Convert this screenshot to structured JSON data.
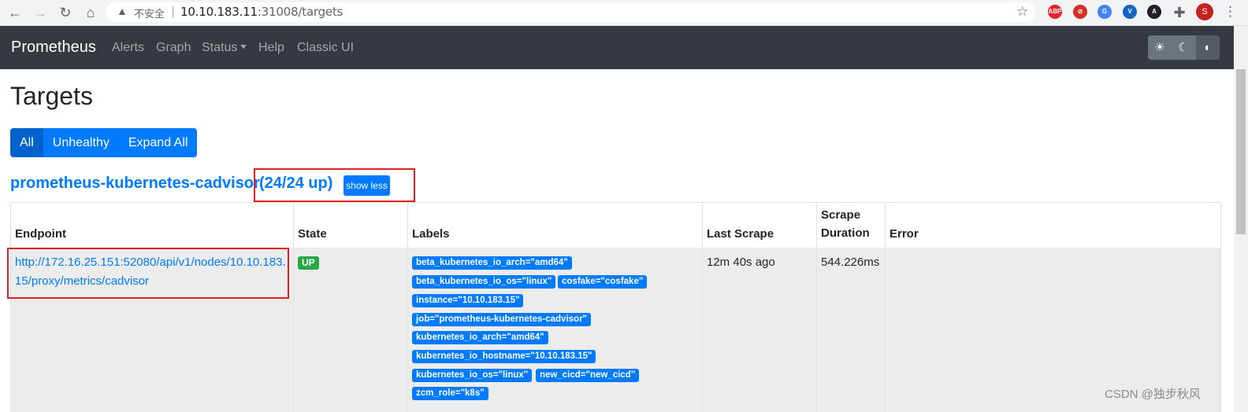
{
  "browser": {
    "insecure_label": "不安全",
    "url_host": "10.10.183.11",
    "url_path": ":31008/targets",
    "avatar_letter": "S",
    "extensions": [
      {
        "name": "abp-icon",
        "text": "ABP",
        "color": "#e4262c"
      },
      {
        "name": "block-icon",
        "text": "⊘",
        "color": "#d93025"
      },
      {
        "name": "translate-icon",
        "text": "G",
        "color": "#4285f4"
      },
      {
        "name": "v-icon",
        "text": "V",
        "color": "#1565c0"
      },
      {
        "name": "arrow-ext-icon",
        "text": "A",
        "color": "#202124"
      }
    ]
  },
  "navbar": {
    "brand": "Prometheus",
    "links": [
      "Alerts",
      "Graph",
      "Status",
      "Help",
      "Classic UI"
    ]
  },
  "page": {
    "title": "Targets",
    "filters": [
      "All",
      "Unhealthy",
      "Expand All"
    ]
  },
  "job": {
    "name": "prometheus-kubernetes-cadvisor",
    "count": "(24/24 up)",
    "toggle_label": "show less"
  },
  "table": {
    "headers": {
      "endpoint": "Endpoint",
      "state": "State",
      "labels": "Labels",
      "last_scrape": "Last Scrape",
      "scrape_duration_1": "Scrape",
      "scrape_duration_2": "Duration",
      "error": "Error"
    },
    "rows": [
      {
        "endpoint": "http://172.16.25.151:52080/api/v1/nodes/10.10.183.15/proxy/metrics/cadvisor",
        "state": "UP",
        "labels": [
          "beta_kubernetes_io_arch=\"amd64\"",
          "beta_kubernetes_io_os=\"linux\"",
          "cosfake=\"cosfake\"",
          "instance=\"10.10.183.15\"",
          "job=\"prometheus-kubernetes-cadvisor\"",
          "kubernetes_io_arch=\"amd64\"",
          "kubernetes_io_hostname=\"10.10.183.15\"",
          "kubernetes_io_os=\"linux\"",
          "new_cicd=\"new_cicd\"",
          "zcm_role=\"k8s\""
        ],
        "last_scrape": "12m 40s ago",
        "scrape_duration": "544.226ms",
        "error": ""
      }
    ]
  },
  "watermark": "CSDN @独步秋风",
  "colors": {
    "primary": "#007bff",
    "success": "#28a745",
    "navbar": "#343a40",
    "annotation": "#e02020"
  }
}
